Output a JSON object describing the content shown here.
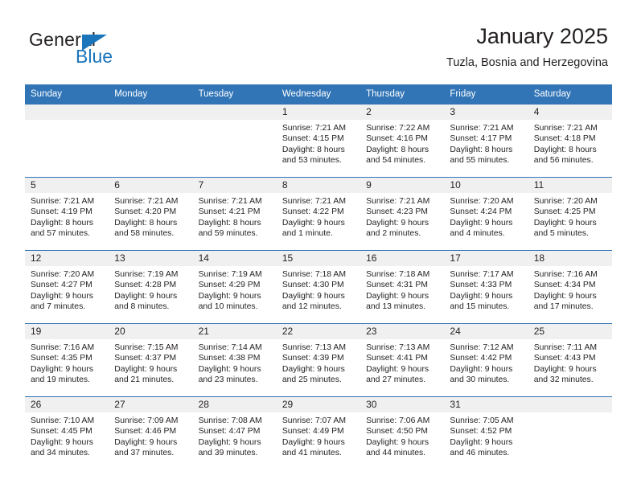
{
  "brand": {
    "name_part1": "General",
    "name_part2": "Blue"
  },
  "header": {
    "title": "January 2025",
    "subtitle": "Tuzla, Bosnia and Herzegovina"
  },
  "colors": {
    "header_blue": "#3175b7",
    "brand_blue": "#1b75bb",
    "daynum_band": "#f0f0f0",
    "text": "#231f20"
  },
  "weekdays": [
    "Sunday",
    "Monday",
    "Tuesday",
    "Wednesday",
    "Thursday",
    "Friday",
    "Saturday"
  ],
  "weeks": [
    [
      {
        "empty": true
      },
      {
        "empty": true
      },
      {
        "empty": true
      },
      {
        "day": "1",
        "sunrise": "Sunrise: 7:21 AM",
        "sunset": "Sunset: 4:15 PM",
        "daylight1": "Daylight: 8 hours",
        "daylight2": "and 53 minutes."
      },
      {
        "day": "2",
        "sunrise": "Sunrise: 7:22 AM",
        "sunset": "Sunset: 4:16 PM",
        "daylight1": "Daylight: 8 hours",
        "daylight2": "and 54 minutes."
      },
      {
        "day": "3",
        "sunrise": "Sunrise: 7:21 AM",
        "sunset": "Sunset: 4:17 PM",
        "daylight1": "Daylight: 8 hours",
        "daylight2": "and 55 minutes."
      },
      {
        "day": "4",
        "sunrise": "Sunrise: 7:21 AM",
        "sunset": "Sunset: 4:18 PM",
        "daylight1": "Daylight: 8 hours",
        "daylight2": "and 56 minutes."
      }
    ],
    [
      {
        "day": "5",
        "sunrise": "Sunrise: 7:21 AM",
        "sunset": "Sunset: 4:19 PM",
        "daylight1": "Daylight: 8 hours",
        "daylight2": "and 57 minutes."
      },
      {
        "day": "6",
        "sunrise": "Sunrise: 7:21 AM",
        "sunset": "Sunset: 4:20 PM",
        "daylight1": "Daylight: 8 hours",
        "daylight2": "and 58 minutes."
      },
      {
        "day": "7",
        "sunrise": "Sunrise: 7:21 AM",
        "sunset": "Sunset: 4:21 PM",
        "daylight1": "Daylight: 8 hours",
        "daylight2": "and 59 minutes."
      },
      {
        "day": "8",
        "sunrise": "Sunrise: 7:21 AM",
        "sunset": "Sunset: 4:22 PM",
        "daylight1": "Daylight: 9 hours",
        "daylight2": "and 1 minute."
      },
      {
        "day": "9",
        "sunrise": "Sunrise: 7:21 AM",
        "sunset": "Sunset: 4:23 PM",
        "daylight1": "Daylight: 9 hours",
        "daylight2": "and 2 minutes."
      },
      {
        "day": "10",
        "sunrise": "Sunrise: 7:20 AM",
        "sunset": "Sunset: 4:24 PM",
        "daylight1": "Daylight: 9 hours",
        "daylight2": "and 4 minutes."
      },
      {
        "day": "11",
        "sunrise": "Sunrise: 7:20 AM",
        "sunset": "Sunset: 4:25 PM",
        "daylight1": "Daylight: 9 hours",
        "daylight2": "and 5 minutes."
      }
    ],
    [
      {
        "day": "12",
        "sunrise": "Sunrise: 7:20 AM",
        "sunset": "Sunset: 4:27 PM",
        "daylight1": "Daylight: 9 hours",
        "daylight2": "and 7 minutes."
      },
      {
        "day": "13",
        "sunrise": "Sunrise: 7:19 AM",
        "sunset": "Sunset: 4:28 PM",
        "daylight1": "Daylight: 9 hours",
        "daylight2": "and 8 minutes."
      },
      {
        "day": "14",
        "sunrise": "Sunrise: 7:19 AM",
        "sunset": "Sunset: 4:29 PM",
        "daylight1": "Daylight: 9 hours",
        "daylight2": "and 10 minutes."
      },
      {
        "day": "15",
        "sunrise": "Sunrise: 7:18 AM",
        "sunset": "Sunset: 4:30 PM",
        "daylight1": "Daylight: 9 hours",
        "daylight2": "and 12 minutes."
      },
      {
        "day": "16",
        "sunrise": "Sunrise: 7:18 AM",
        "sunset": "Sunset: 4:31 PM",
        "daylight1": "Daylight: 9 hours",
        "daylight2": "and 13 minutes."
      },
      {
        "day": "17",
        "sunrise": "Sunrise: 7:17 AM",
        "sunset": "Sunset: 4:33 PM",
        "daylight1": "Daylight: 9 hours",
        "daylight2": "and 15 minutes."
      },
      {
        "day": "18",
        "sunrise": "Sunrise: 7:16 AM",
        "sunset": "Sunset: 4:34 PM",
        "daylight1": "Daylight: 9 hours",
        "daylight2": "and 17 minutes."
      }
    ],
    [
      {
        "day": "19",
        "sunrise": "Sunrise: 7:16 AM",
        "sunset": "Sunset: 4:35 PM",
        "daylight1": "Daylight: 9 hours",
        "daylight2": "and 19 minutes."
      },
      {
        "day": "20",
        "sunrise": "Sunrise: 7:15 AM",
        "sunset": "Sunset: 4:37 PM",
        "daylight1": "Daylight: 9 hours",
        "daylight2": "and 21 minutes."
      },
      {
        "day": "21",
        "sunrise": "Sunrise: 7:14 AM",
        "sunset": "Sunset: 4:38 PM",
        "daylight1": "Daylight: 9 hours",
        "daylight2": "and 23 minutes."
      },
      {
        "day": "22",
        "sunrise": "Sunrise: 7:13 AM",
        "sunset": "Sunset: 4:39 PM",
        "daylight1": "Daylight: 9 hours",
        "daylight2": "and 25 minutes."
      },
      {
        "day": "23",
        "sunrise": "Sunrise: 7:13 AM",
        "sunset": "Sunset: 4:41 PM",
        "daylight1": "Daylight: 9 hours",
        "daylight2": "and 27 minutes."
      },
      {
        "day": "24",
        "sunrise": "Sunrise: 7:12 AM",
        "sunset": "Sunset: 4:42 PM",
        "daylight1": "Daylight: 9 hours",
        "daylight2": "and 30 minutes."
      },
      {
        "day": "25",
        "sunrise": "Sunrise: 7:11 AM",
        "sunset": "Sunset: 4:43 PM",
        "daylight1": "Daylight: 9 hours",
        "daylight2": "and 32 minutes."
      }
    ],
    [
      {
        "day": "26",
        "sunrise": "Sunrise: 7:10 AM",
        "sunset": "Sunset: 4:45 PM",
        "daylight1": "Daylight: 9 hours",
        "daylight2": "and 34 minutes."
      },
      {
        "day": "27",
        "sunrise": "Sunrise: 7:09 AM",
        "sunset": "Sunset: 4:46 PM",
        "daylight1": "Daylight: 9 hours",
        "daylight2": "and 37 minutes."
      },
      {
        "day": "28",
        "sunrise": "Sunrise: 7:08 AM",
        "sunset": "Sunset: 4:47 PM",
        "daylight1": "Daylight: 9 hours",
        "daylight2": "and 39 minutes."
      },
      {
        "day": "29",
        "sunrise": "Sunrise: 7:07 AM",
        "sunset": "Sunset: 4:49 PM",
        "daylight1": "Daylight: 9 hours",
        "daylight2": "and 41 minutes."
      },
      {
        "day": "30",
        "sunrise": "Sunrise: 7:06 AM",
        "sunset": "Sunset: 4:50 PM",
        "daylight1": "Daylight: 9 hours",
        "daylight2": "and 44 minutes."
      },
      {
        "day": "31",
        "sunrise": "Sunrise: 7:05 AM",
        "sunset": "Sunset: 4:52 PM",
        "daylight1": "Daylight: 9 hours",
        "daylight2": "and 46 minutes."
      },
      {
        "empty": true
      }
    ]
  ]
}
